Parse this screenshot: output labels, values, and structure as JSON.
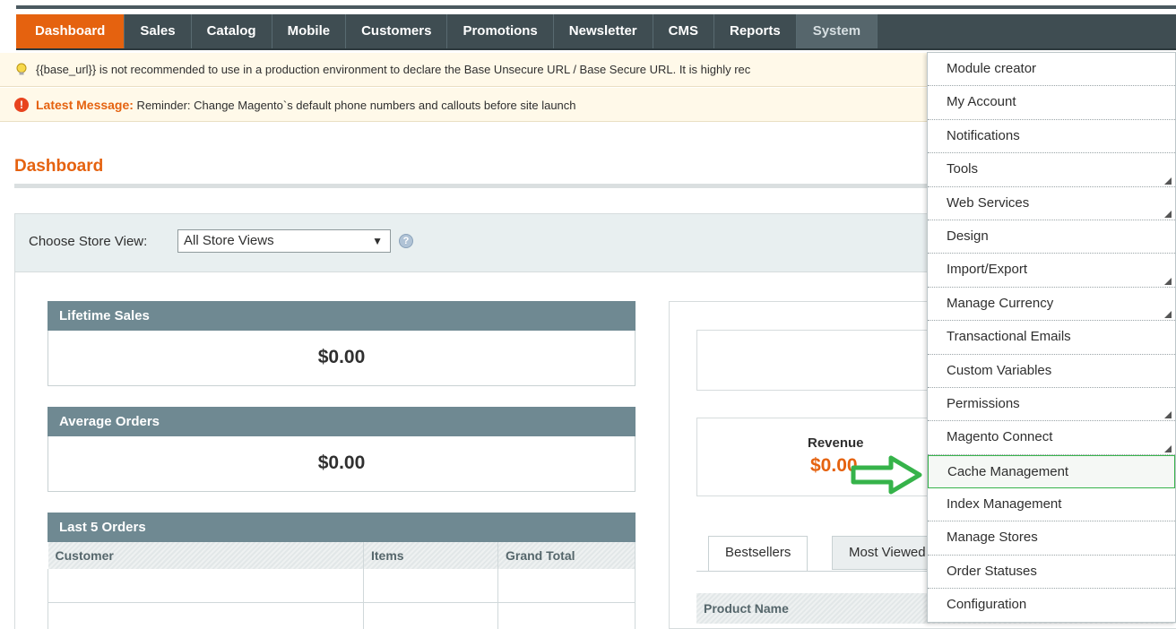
{
  "nav": {
    "items": [
      "Dashboard",
      "Sales",
      "Catalog",
      "Mobile",
      "Customers",
      "Promotions",
      "Newsletter",
      "CMS",
      "Reports",
      "System"
    ]
  },
  "notices": {
    "warning": "{{base_url}} is not recommended to use in a production environment to declare the Base Unsecure URL / Base Secure URL. It is highly rec",
    "latest_label": "Latest Message:",
    "latest_text": " Reminder: Change Magento`s default phone numbers and callouts before site launch"
  },
  "page": {
    "title": "Dashboard"
  },
  "store_view": {
    "label": "Choose Store View:",
    "selected": "All Store Views",
    "help": "?"
  },
  "lifetime_sales": {
    "title": "Lifetime Sales",
    "value": "$0.00"
  },
  "average_orders": {
    "title": "Average Orders",
    "value": "$0.00"
  },
  "last_orders": {
    "title": "Last 5 Orders",
    "columns": [
      "Customer",
      "Items",
      "Grand Total"
    ]
  },
  "revenue": {
    "label": "Revenue",
    "value": "$0.00"
  },
  "tabs": [
    "Bestsellers",
    "Most Viewed"
  ],
  "product_table": {
    "column": "Product Name"
  },
  "system_menu": {
    "items": [
      {
        "label": "Module creator",
        "submenu": false
      },
      {
        "label": "My Account",
        "submenu": false
      },
      {
        "label": "Notifications",
        "submenu": false
      },
      {
        "label": "Tools",
        "submenu": true
      },
      {
        "label": "Web Services",
        "submenu": true
      },
      {
        "label": "Design",
        "submenu": false
      },
      {
        "label": "Import/Export",
        "submenu": true
      },
      {
        "label": "Manage Currency",
        "submenu": true
      },
      {
        "label": "Transactional Emails",
        "submenu": false
      },
      {
        "label": "Custom Variables",
        "submenu": false
      },
      {
        "label": "Permissions",
        "submenu": true
      },
      {
        "label": "Magento Connect",
        "submenu": true
      },
      {
        "label": "Cache Management",
        "submenu": false
      },
      {
        "label": "Index Management",
        "submenu": false
      },
      {
        "label": "Manage Stores",
        "submenu": false
      },
      {
        "label": "Order Statuses",
        "submenu": false
      },
      {
        "label": "Configuration",
        "submenu": false
      }
    ]
  },
  "colors": {
    "accent": "#e5620f",
    "nav_bg": "#3f4d52",
    "highlight_arrow": "#36b34a"
  }
}
